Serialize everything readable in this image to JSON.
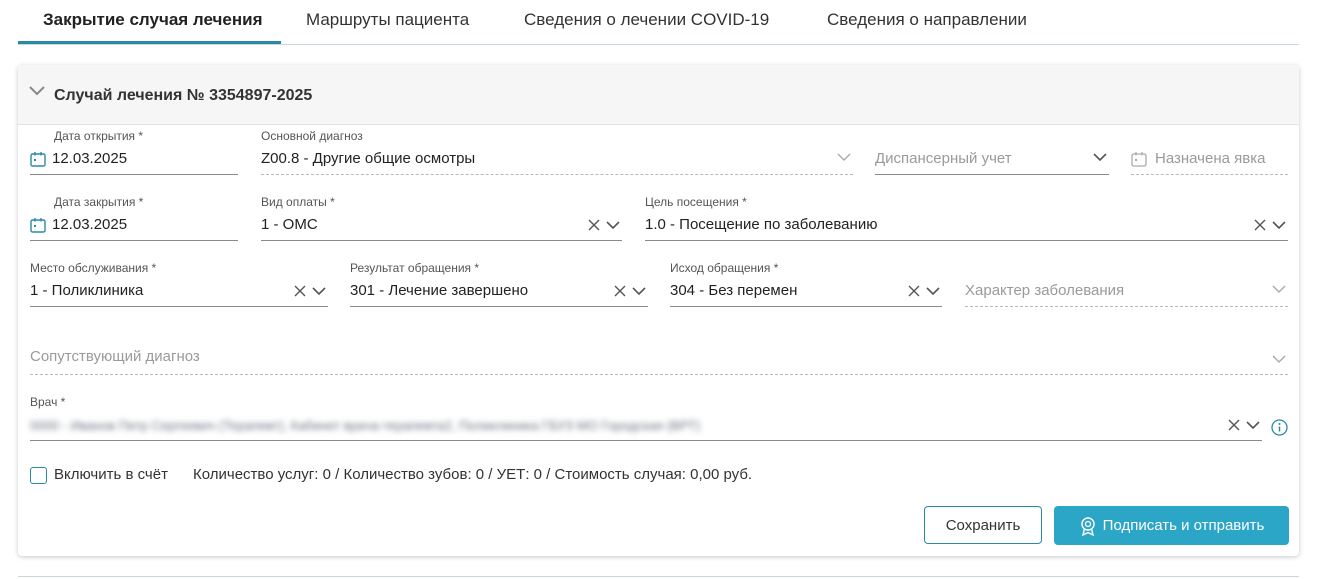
{
  "tabs": [
    {
      "label": "Закрытие случая лечения",
      "active": true
    },
    {
      "label": "Маршруты пациента"
    },
    {
      "label": "Сведения о лечении COVID-19"
    },
    {
      "label": "Сведения о направлении"
    }
  ],
  "case": {
    "title": "Случай лечения № 3354897-2025"
  },
  "fields": {
    "open_date": {
      "label": "Дата открытия *",
      "value": "12.03.2025"
    },
    "main_diagnosis": {
      "label": "Основной диагноз",
      "value": "Z00.8 - Другие общие осмотры"
    },
    "dispensary": {
      "placeholder": "Диспансерный учет"
    },
    "appointment": {
      "placeholder": "Назначена явка"
    },
    "close_date": {
      "label": "Дата закрытия *",
      "value": "12.03.2025"
    },
    "payment_type": {
      "label": "Вид оплаты *",
      "value": "1 - ОМС"
    },
    "visit_goal": {
      "label": "Цель посещения *",
      "value": "1.0 - Посещение по заболеванию"
    },
    "service_place": {
      "label": "Место обслуживания *",
      "value": "1 - Поликлиника"
    },
    "result": {
      "label": "Результат обращения *",
      "value": "301 - Лечение завершено"
    },
    "outcome": {
      "label": "Исход обращения *",
      "value": "304 - Без перемен"
    },
    "disease_character": {
      "placeholder": "Характер заболевания"
    },
    "concomitant_diagnosis": {
      "placeholder": "Сопутствующий диагноз"
    },
    "doctor": {
      "label": "Врач *",
      "value": "0000 - Иванов Петр Сергеевич (Терапевт), Кабинет врача-терапевта2, Поликлиника ГБУЗ МО Городская (ВРТ)"
    }
  },
  "footer": {
    "include_label": "Включить в счёт",
    "summary": "Количество услуг: 0 / Количество зубов: 0 / УЕТ: 0 / Стоимость случая: 0,00 руб.",
    "save_label": "Сохранить",
    "sign_label": "Подписать и отправить"
  },
  "colors": {
    "accent": "#2a8aa5",
    "primary_button": "#2ba6c7"
  }
}
